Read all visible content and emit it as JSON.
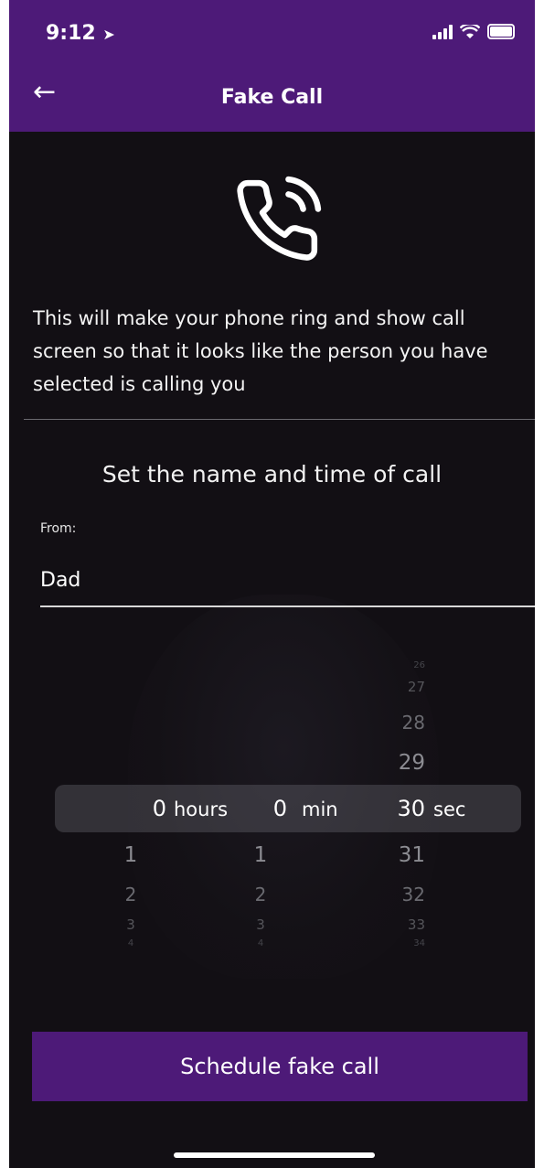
{
  "status_bar": {
    "time": "9:12"
  },
  "app_bar": {
    "title": "Fake Call",
    "back_icon": "arrow-left-icon"
  },
  "header_icon": "phone-ringing-icon",
  "description": "This will make your phone ring and show call screen so that it looks like the person you have selected is calling you",
  "section_title": "Set the name and time of call",
  "from_field": {
    "label": "From:",
    "value": "Dad"
  },
  "picker": {
    "hours": {
      "selected": "0",
      "unit": "hours",
      "below": [
        "1",
        "2",
        "3",
        "4"
      ]
    },
    "minutes": {
      "selected": "0",
      "unit": "min",
      "below": [
        "1",
        "2",
        "3",
        "4"
      ]
    },
    "seconds": {
      "selected": "30",
      "unit": "sec",
      "above": [
        "26",
        "27",
        "28",
        "29"
      ],
      "below": [
        "31",
        "32",
        "33",
        "34"
      ]
    }
  },
  "schedule_button": {
    "label": "Schedule fake call"
  },
  "colors": {
    "accent": "#4d1a78",
    "background": "#120f14"
  }
}
